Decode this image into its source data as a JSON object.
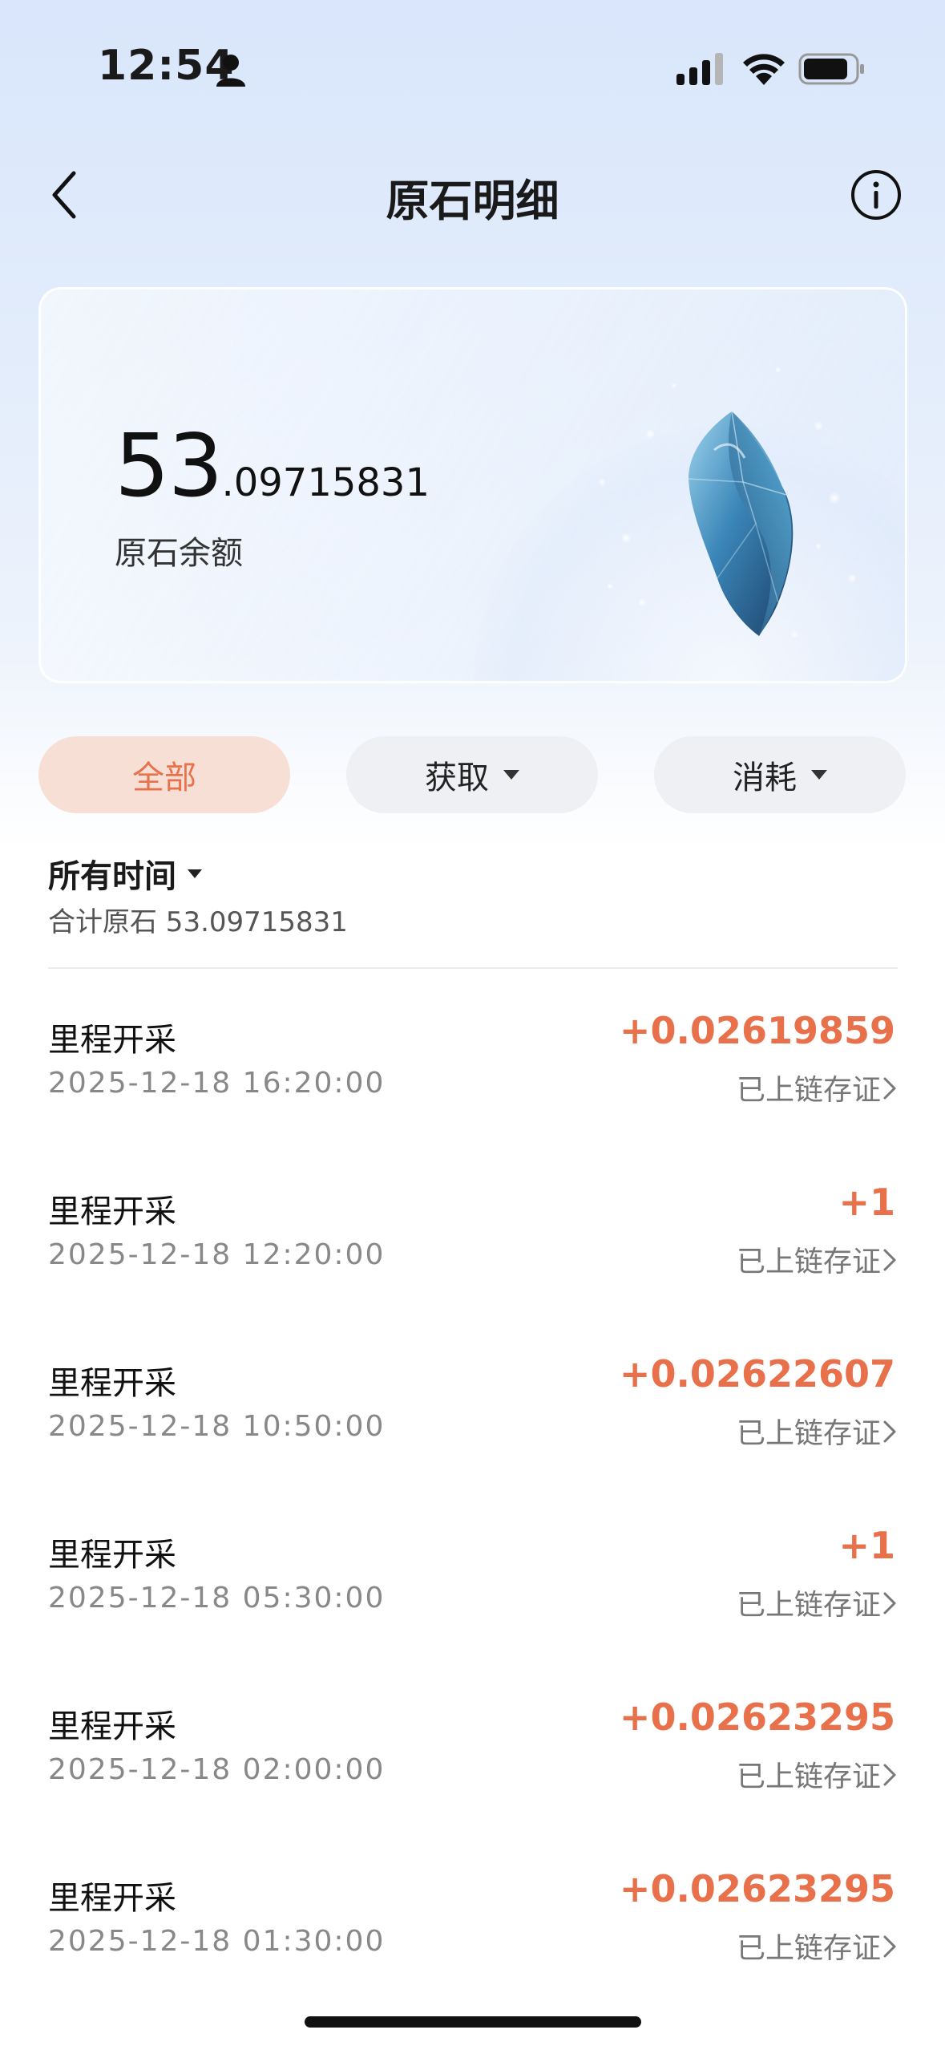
{
  "status_bar": {
    "time": "12:54"
  },
  "header": {
    "title": "原石明细"
  },
  "balance": {
    "integer": "53",
    "decimal": ".09715831",
    "label": "原石余额"
  },
  "filters": {
    "all": "全部",
    "gain": "获取",
    "spend": "消耗"
  },
  "time_filter": {
    "label": "所有时间",
    "total": "合计原石 53.09715831"
  },
  "records": [
    {
      "title": "里程开采",
      "time": "2025-12-18 16:20:00",
      "amount": "+0.02619859",
      "status": "已上链存证"
    },
    {
      "title": "里程开采",
      "time": "2025-12-18 12:20:00",
      "amount": "+1",
      "status": "已上链存证"
    },
    {
      "title": "里程开采",
      "time": "2025-12-18 10:50:00",
      "amount": "+0.02622607",
      "status": "已上链存证"
    },
    {
      "title": "里程开采",
      "time": "2025-12-18 05:30:00",
      "amount": "+1",
      "status": "已上链存证"
    },
    {
      "title": "里程开采",
      "time": "2025-12-18 02:00:00",
      "amount": "+0.02623295",
      "status": "已上链存证"
    },
    {
      "title": "里程开采",
      "time": "2025-12-18 01:30:00",
      "amount": "+0.02623295",
      "status": "已上链存证"
    }
  ],
  "colors": {
    "accent": "#e8704a",
    "active_tab_bg": "#f7dfd6",
    "header_bg": "#dce7fb"
  }
}
